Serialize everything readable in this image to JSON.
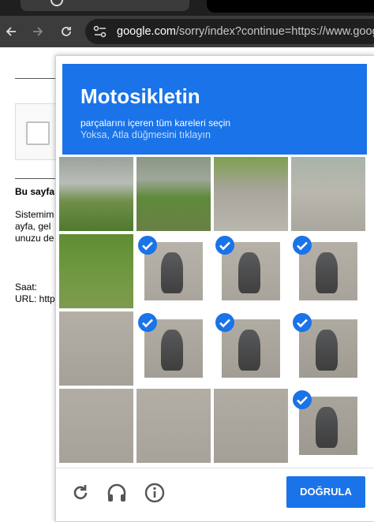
{
  "browser": {
    "url_host": "google.com",
    "url_rest": "/sorry/index?continue=https://www.goog"
  },
  "page": {
    "heading": "Bu sayfa",
    "para_line1": "Sistemim",
    "para_line2": "ayfa, gel",
    "para_line3": "unuzu de",
    "time_label": "Saat:",
    "url_label": "URL: http"
  },
  "captcha": {
    "title": "Motosikletin",
    "subtitle": "parçalarını içeren tüm kareleri seçin",
    "skip_hint": "Yoksa, Atla düğmesini tıklayın",
    "verify_label": "DOĞRULA",
    "colors": {
      "accent": "#1a73e8"
    },
    "tiles": [
      {
        "selected": false
      },
      {
        "selected": false
      },
      {
        "selected": false
      },
      {
        "selected": false
      },
      {
        "selected": false
      },
      {
        "selected": true
      },
      {
        "selected": true
      },
      {
        "selected": true
      },
      {
        "selected": false
      },
      {
        "selected": true
      },
      {
        "selected": true
      },
      {
        "selected": true
      },
      {
        "selected": false
      },
      {
        "selected": false
      },
      {
        "selected": false
      },
      {
        "selected": true
      }
    ],
    "footer_icons": [
      "reload-icon",
      "audio-icon",
      "info-icon"
    ]
  }
}
